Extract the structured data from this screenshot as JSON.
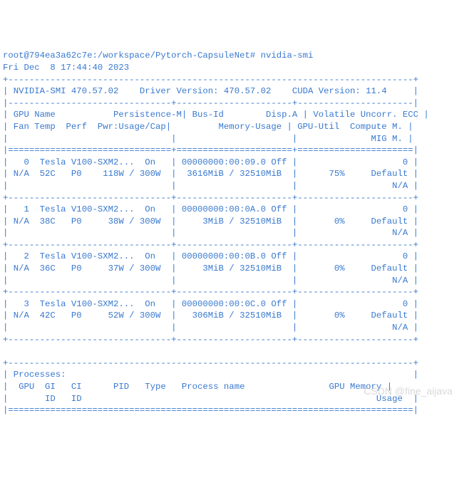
{
  "prompt": {
    "user_host": "root@794ea3a62c7e",
    "path": "/workspace/Pytorch-CapsuleNet",
    "command": "nvidia-smi"
  },
  "timestamp": "Fri Dec  8 17:44:40 2023",
  "header": {
    "smi_version_label": "NVIDIA-SMI",
    "smi_version": "470.57.02",
    "driver_label": "Driver Version:",
    "driver_version": "470.57.02",
    "cuda_label": "CUDA Version:",
    "cuda_version": "11.4"
  },
  "columns": {
    "gpu": "GPU",
    "name": "Name",
    "persistence": "Persistence-M",
    "bus_id": "Bus-Id",
    "disp": "Disp.A",
    "volatile": "Volatile",
    "uncorr_ecc": "Uncorr. ECC",
    "fan": "Fan",
    "temp": "Temp",
    "perf": "Perf",
    "pwr": "Pwr:Usage/Cap",
    "memory": "Memory-Usage",
    "gpu_util": "GPU-Util",
    "compute": "Compute M.",
    "mig": "MIG M."
  },
  "gpus": [
    {
      "idx": "0",
      "name": "Tesla V100-SXM2...",
      "pm": "On",
      "bus": "00000000:00:09.0",
      "disp": "Off",
      "ecc": "0",
      "fan": "N/A",
      "temp": "52C",
      "perf": "P0",
      "pwr_usage": "118W",
      "pwr_cap": "300W",
      "mem_used": "3616MiB",
      "mem_total": "32510MiB",
      "util": "75%",
      "compute": "Default",
      "mig": "N/A"
    },
    {
      "idx": "1",
      "name": "Tesla V100-SXM2...",
      "pm": "On",
      "bus": "00000000:00:0A.0",
      "disp": "Off",
      "ecc": "0",
      "fan": "N/A",
      "temp": "38C",
      "perf": "P0",
      "pwr_usage": "38W",
      "pwr_cap": "300W",
      "mem_used": "3MiB",
      "mem_total": "32510MiB",
      "util": "0%",
      "compute": "Default",
      "mig": "N/A"
    },
    {
      "idx": "2",
      "name": "Tesla V100-SXM2...",
      "pm": "On",
      "bus": "00000000:00:0B.0",
      "disp": "Off",
      "ecc": "0",
      "fan": "N/A",
      "temp": "36C",
      "perf": "P0",
      "pwr_usage": "37W",
      "pwr_cap": "300W",
      "mem_used": "3MiB",
      "mem_total": "32510MiB",
      "util": "0%",
      "compute": "Default",
      "mig": "N/A"
    },
    {
      "idx": "3",
      "name": "Tesla V100-SXM2...",
      "pm": "On",
      "bus": "00000000:00:0C.0",
      "disp": "Off",
      "ecc": "0",
      "fan": "N/A",
      "temp": "42C",
      "perf": "P0",
      "pwr_usage": "52W",
      "pwr_cap": "300W",
      "mem_used": "306MiB",
      "mem_total": "32510MiB",
      "util": "0%",
      "compute": "Default",
      "mig": "N/A"
    }
  ],
  "processes_header": {
    "title": "Processes:",
    "gpu": "GPU",
    "gi": "GI",
    "ci": "CI",
    "pid": "PID",
    "type": "Type",
    "process_name": "Process name",
    "gpu_memory": "GPU Memory",
    "id": "ID",
    "usage": "Usage"
  },
  "watermark": "CSDN @fine_aijava"
}
